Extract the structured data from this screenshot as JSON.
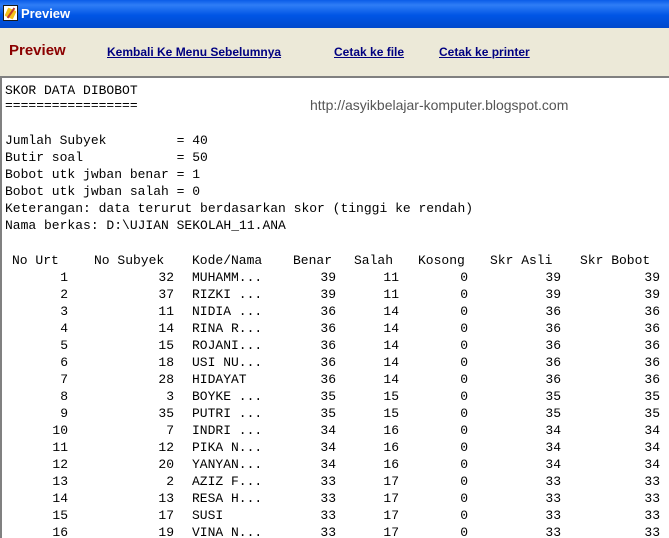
{
  "window": {
    "title": "Preview"
  },
  "toolbar": {
    "preview_label": "Preview",
    "back_label": "Kembali Ke Menu Sebelumnya",
    "file_label": "Cetak ke file",
    "printer_label": "Cetak ke printer"
  },
  "report": {
    "title": "SKOR DATA DIBOBOT",
    "underline": "=================",
    "watermark": "http://asyikbelajar-komputer.blogspot.com",
    "meta": [
      "Jumlah Subyek         = 40",
      "Butir soal            = 50",
      "Bobot utk jwban benar = 1",
      "Bobot utk jwban salah = 0",
      "Keterangan: data terurut berdasarkan skor (tinggi ke rendah)",
      "Nama berkas: D:\\UJIAN SEKOLAH_11.ANA"
    ],
    "columns": [
      "No Urt",
      "No Subyek",
      "Kode/Nama",
      "Benar",
      "Salah",
      "Kosong",
      "Skr Asli",
      "Skr Bobot"
    ],
    "rows": [
      [
        "1",
        "32",
        "MUHAMM...",
        "39",
        "11",
        "0",
        "39",
        "39"
      ],
      [
        "2",
        "37",
        "RIZKI ...",
        "39",
        "11",
        "0",
        "39",
        "39"
      ],
      [
        "3",
        "11",
        "NIDIA ...",
        "36",
        "14",
        "0",
        "36",
        "36"
      ],
      [
        "4",
        "14",
        "RINA R...",
        "36",
        "14",
        "0",
        "36",
        "36"
      ],
      [
        "5",
        "15",
        "ROJANI...",
        "36",
        "14",
        "0",
        "36",
        "36"
      ],
      [
        "6",
        "18",
        "USI NU...",
        "36",
        "14",
        "0",
        "36",
        "36"
      ],
      [
        "7",
        "28",
        "HIDAYAT",
        "36",
        "14",
        "0",
        "36",
        "36"
      ],
      [
        "8",
        "3",
        "BOYKE ...",
        "35",
        "15",
        "0",
        "35",
        "35"
      ],
      [
        "9",
        "35",
        "PUTRI ...",
        "35",
        "15",
        "0",
        "35",
        "35"
      ],
      [
        "10",
        "7",
        "INDRI ...",
        "34",
        "16",
        "0",
        "34",
        "34"
      ],
      [
        "11",
        "12",
        "PIKA N...",
        "34",
        "16",
        "0",
        "34",
        "34"
      ],
      [
        "12",
        "20",
        "YANYAN...",
        "34",
        "16",
        "0",
        "34",
        "34"
      ],
      [
        "13",
        "2",
        "AZIZ F...",
        "33",
        "17",
        "0",
        "33",
        "33"
      ],
      [
        "14",
        "13",
        "RESA H...",
        "33",
        "17",
        "0",
        "33",
        "33"
      ],
      [
        "15",
        "17",
        "SUSI",
        "33",
        "17",
        "0",
        "33",
        "33"
      ],
      [
        "16",
        "19",
        "VINA N...",
        "33",
        "17",
        "0",
        "33",
        "33"
      ]
    ]
  }
}
